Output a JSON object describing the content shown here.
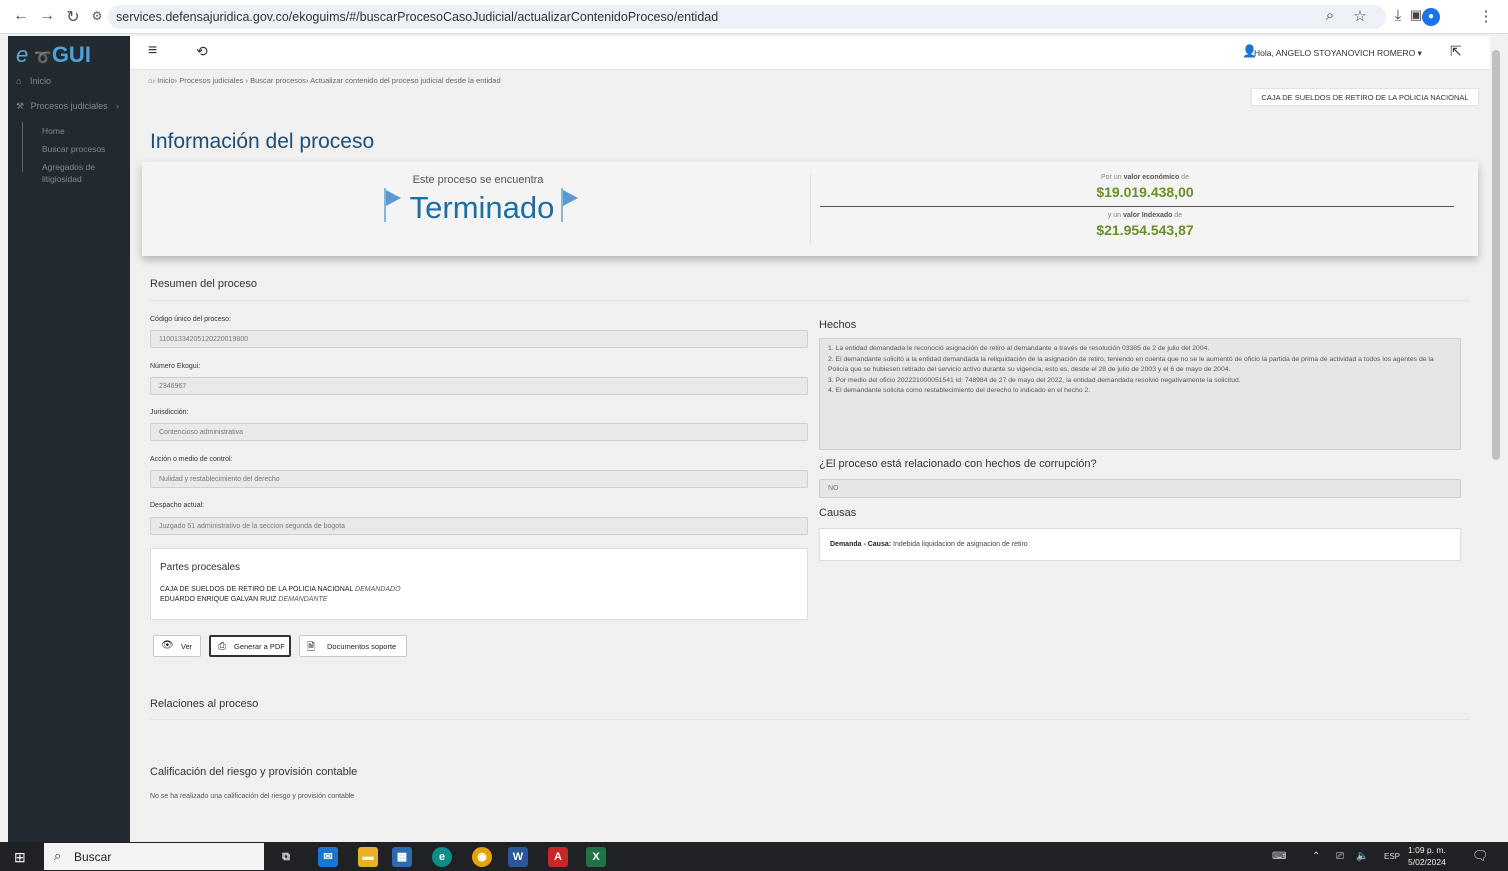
{
  "browser": {
    "url": "services.defensajuridica.gov.co/ekoguims/#/buscarProcesoCasoJudicial/actualizarContenidoProceso/entidad"
  },
  "sidebar": {
    "logo_prefix": "e",
    "logo_main": "GUI",
    "items": [
      {
        "label": "Inicio"
      },
      {
        "label": "Procesos judiciales"
      }
    ],
    "sub_items": [
      {
        "label": "Home"
      },
      {
        "label": "Buscar procesos"
      },
      {
        "label": "Agregados de litigiosidad"
      }
    ]
  },
  "header": {
    "user_greeting": "Hola, ANGELO STOYANOVICH ROMERO"
  },
  "breadcrumb": "› Inicio› Procesos judiciales › Buscar procesos› Actualizar contenido del proceso judicial desde la entidad",
  "entity": "CAJA DE SUELDOS DE RETIRO DE LA POLICIA NACIONAL",
  "page_title": "Información del proceso",
  "status": {
    "label": "Este proceso se encuentra",
    "value": "Terminado",
    "economic_prefix": "Por un ",
    "economic_bold": "valor económico",
    "economic_suffix": " de",
    "economic_amount": "$19.019.438,00",
    "indexed_prefix": "y un ",
    "indexed_bold": "valor Indexado",
    "indexed_suffix": " de",
    "indexed_amount": "$21.954.543,87"
  },
  "resumen": {
    "heading": "Resumen del proceso",
    "fields": [
      {
        "label": "Código único del proceso:",
        "value": "11001334205120220019800"
      },
      {
        "label": "Número Ekogui:",
        "value": "2346967"
      },
      {
        "label": "Jurisdicción:",
        "value": "Contencioso administrativa"
      },
      {
        "label": "Acción o medio de control:",
        "value": "Nulidad y restablecimiento del derecho"
      },
      {
        "label": "Despacho actual:",
        "value": "Juzgado 51 administrativo de la seccion segunda de bogota"
      }
    ]
  },
  "partes": {
    "heading": "Partes procesales",
    "items": [
      {
        "name": "CAJA DE SUELDOS DE RETIRO DE LA POLICIA NACIONAL",
        "role": "DEMANDADO"
      },
      {
        "name": "EDUARDO ENRIQUE GALVAN RUIZ",
        "role": "DEMANDANTE"
      }
    ]
  },
  "buttons": {
    "ver": "Ver",
    "pdf": "Generar a PDF",
    "docs": "Documentos soporte"
  },
  "hechos": {
    "heading": "Hechos",
    "lines": [
      "1.    La entidad demandada le reconoció asignación de retiro al demandante a través de resolución 03385 de 2 de julio del 2004.",
      "2.    El demandante solicitó a la entidad demandada la reliquidación de la asignación de retiro, teniendo en cuenta que no se le aumentó de oficio la partida de prima de actividad a todos los agentes de la Policía que se hubiesen retirado del servicio activo durante su vigencia, esto es, desde el 28 de julio de 2003 y el 6 de mayo de 2004.",
      "3.    Por medio del oficio 202221000051541 id: 748984 de 27 de mayo del 2022, la entidad demandada resolvió negativamente la solicitud.",
      "4.    El demandante solicita como restablecimiento del derecho lo indicado en el hecho 2."
    ]
  },
  "corrupcion": {
    "question": "¿El proceso está relacionado con hechos de corrupción?",
    "value": "NO"
  },
  "causas": {
    "heading": "Causas",
    "label": "Demanda - Causa:",
    "value": "Indebida liquidacion de asignacion de retiro"
  },
  "relaciones": {
    "heading": "Relaciones al proceso"
  },
  "calificacion": {
    "heading": "Calificación del riesgo y provisión contable",
    "note": "No se ha realizado una calificación del riesgo y provisión contable"
  },
  "taskbar": {
    "search_label": "Buscar",
    "language": "ESP",
    "time": "1:09 p. m.",
    "date": "5/02/2024"
  }
}
